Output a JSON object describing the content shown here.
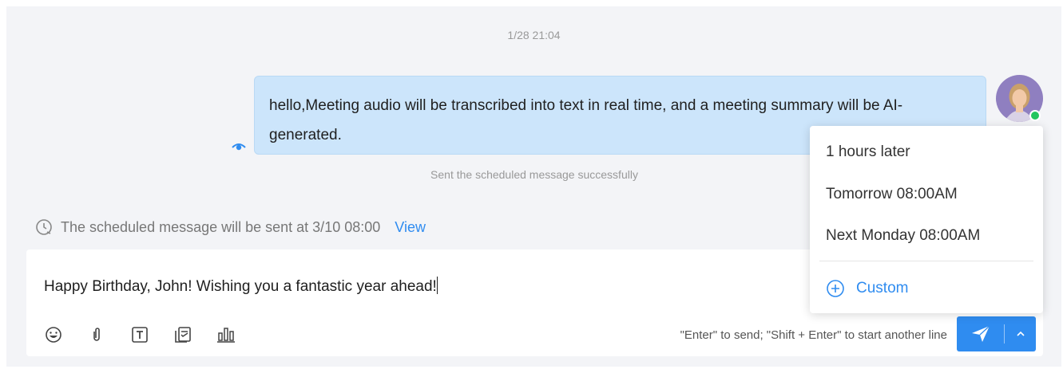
{
  "chat": {
    "timestamp": "1/28 21:04",
    "message": "hello,Meeting audio will be transcribed into text in real time, and a meeting summary will be AI-generated.",
    "sent_status": "Sent the scheduled message successfully"
  },
  "scheduled": {
    "notice": "The scheduled message will be sent at 3/10 08:00",
    "view_label": "View"
  },
  "composer": {
    "text": "Happy Birthday, John! Wishing you a fantastic year ahead!",
    "hint": "\"Enter\" to send; \"Shift + Enter\" to start another line",
    "tools": [
      "emoji-icon",
      "attachment-icon",
      "text-format-icon",
      "task-icon",
      "poll-icon"
    ]
  },
  "schedule_menu": {
    "options": [
      "1 hours later",
      "Tomorrow 08:00AM",
      "Next Monday 08:00AM"
    ],
    "custom_label": "Custom"
  },
  "colors": {
    "accent": "#2f8cf0",
    "bubble": "#cce5fb",
    "online": "#22c55e"
  }
}
